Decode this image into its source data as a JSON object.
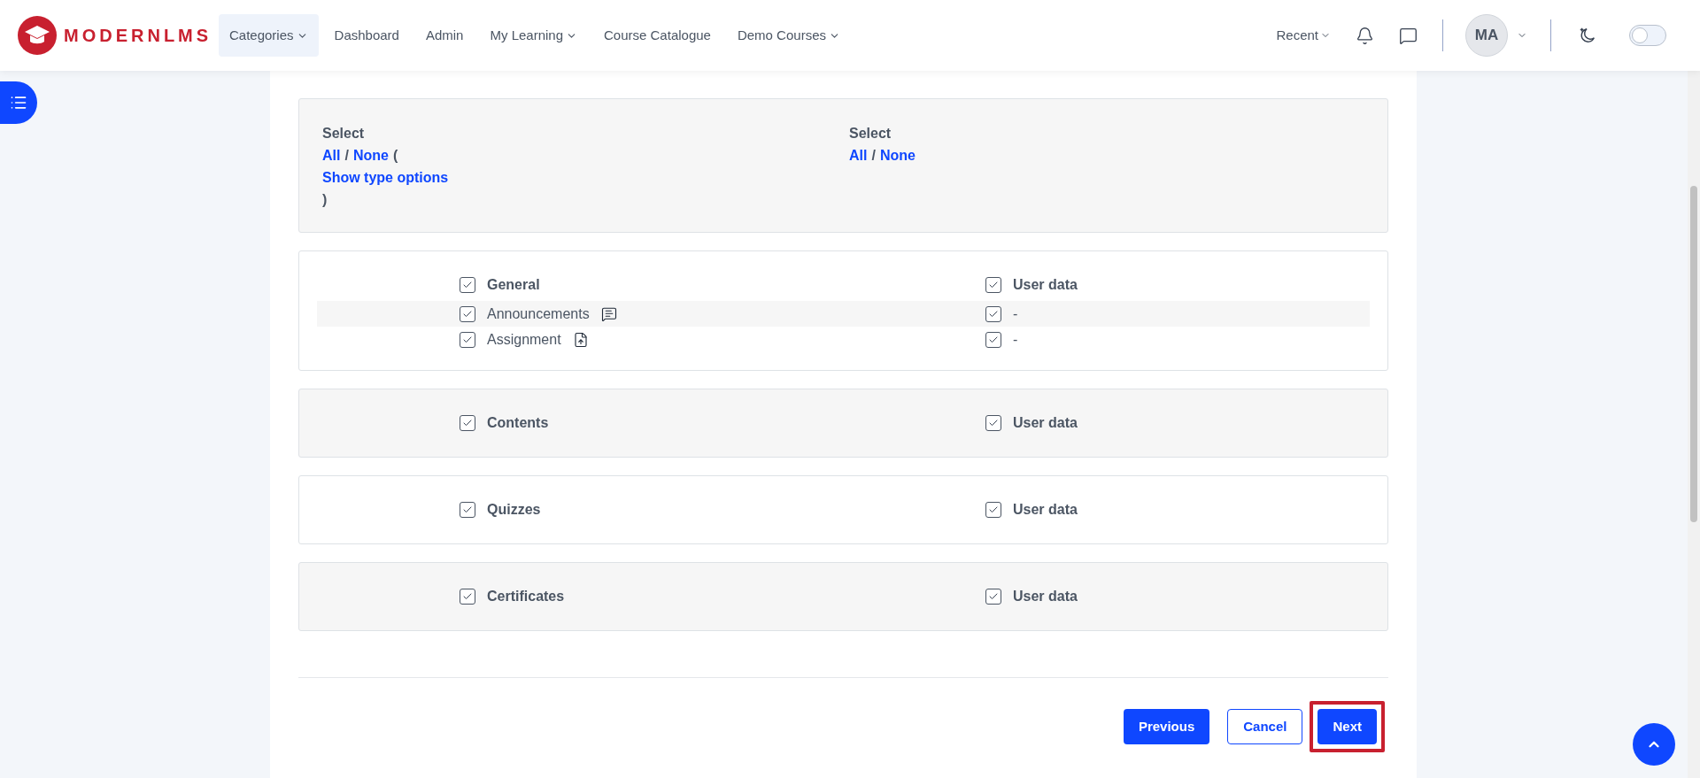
{
  "header": {
    "logo": "MODERNLMS",
    "nav": [
      {
        "label": "Categories",
        "dropdown": true,
        "selected": true
      },
      {
        "label": "Dashboard",
        "dropdown": false,
        "selected": false
      },
      {
        "label": "Admin",
        "dropdown": false,
        "selected": false
      },
      {
        "label": "My Learning",
        "dropdown": true,
        "selected": false
      },
      {
        "label": "Course Catalogue",
        "dropdown": false,
        "selected": false
      },
      {
        "label": "Demo Courses",
        "dropdown": true,
        "selected": false
      }
    ],
    "recent": "Recent",
    "avatar": "MA",
    "dark_mode": {
      "on": false
    }
  },
  "select_panel": {
    "left": {
      "label": "Select",
      "all": "All",
      "slash": "/",
      "none": "None",
      "open_paren": "(",
      "type_options": "Show type options",
      "close_paren": ")"
    },
    "right": {
      "label": "Select",
      "all": "All",
      "slash": "/",
      "none": "None"
    }
  },
  "sections": [
    {
      "title": "General",
      "checked": true,
      "user_data": "User data",
      "user_data_checked": true,
      "items": [
        {
          "label": "Announcements",
          "kind": "forum",
          "checked": true,
          "user_data_checked": true,
          "user_data_value": "-"
        },
        {
          "label": "Assignment",
          "kind": "assignment",
          "checked": true,
          "user_data_checked": true,
          "user_data_value": "-"
        }
      ]
    },
    {
      "title": "Contents",
      "checked": true,
      "user_data": "User data",
      "user_data_checked": true
    },
    {
      "title": "Quizzes",
      "checked": true,
      "user_data": "User data",
      "user_data_checked": true
    },
    {
      "title": "Certificates",
      "checked": true,
      "user_data": "User data",
      "user_data_checked": true
    }
  ],
  "buttons": [
    {
      "label": "Previous",
      "kind": "primary",
      "highlighted": false
    },
    {
      "label": "Cancel",
      "kind": "outline",
      "highlighted": false
    },
    {
      "label": "Next",
      "kind": "primary",
      "highlighted": true
    }
  ]
}
